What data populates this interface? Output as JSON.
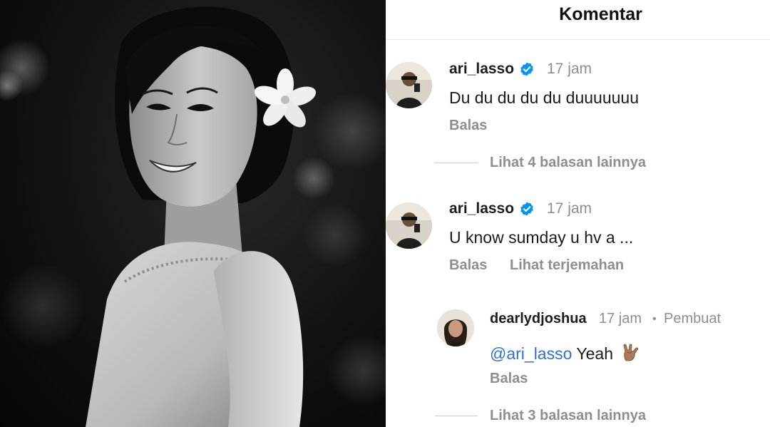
{
  "header": {
    "title": "Komentar"
  },
  "comments": [
    {
      "username": "ari_lasso",
      "verified": true,
      "time": "17 jam",
      "text": "Du du du du du duuuuuuu",
      "reply_label": "Balas",
      "view_replies": "Lihat 4 balasan lainnya"
    },
    {
      "username": "ari_lasso",
      "verified": true,
      "time": "17 jam",
      "text": "U know sumday u hv a ...",
      "reply_label": "Balas",
      "translate_label": "Lihat terjemahan",
      "replies": [
        {
          "username": "dearlydjoshua",
          "time": "17 jam",
          "separator": "•",
          "author_badge": "Pembuat",
          "mention": "@ari_lasso",
          "text": "Yeah",
          "emoji": "sign-of-the-horns-emoji",
          "reply_label": "Balas"
        }
      ],
      "view_replies": "Lihat 3 balasan lainnya"
    }
  ],
  "colors": {
    "accent_blue": "#2f6fdb",
    "verified_badge": "#0095f6",
    "muted_gray": "#8e8e8e"
  }
}
